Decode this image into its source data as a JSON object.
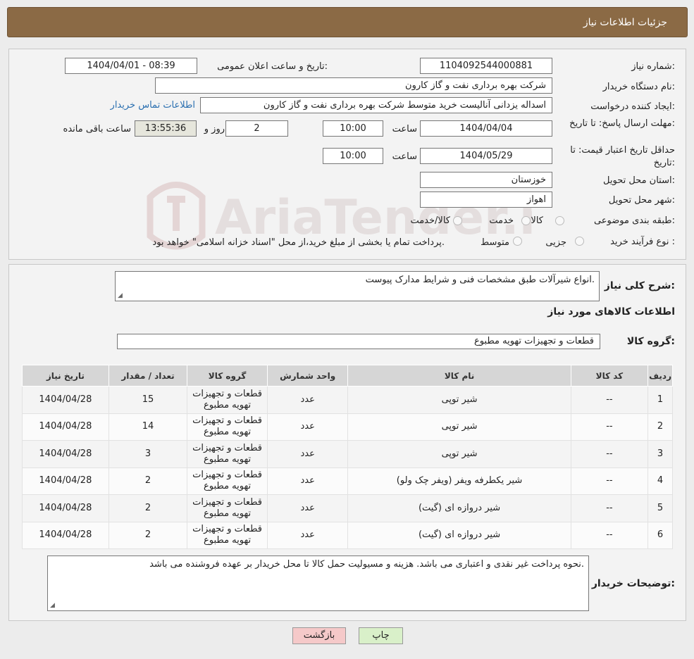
{
  "page": {
    "title": "جزئیات اطلاعات نیاز"
  },
  "need": {
    "number_label": "شماره نیاز:",
    "number": "1104092544000881",
    "announce_label": "تاریخ و ساعت اعلان عمومی:",
    "announce_value": "1404/04/01 - 08:39",
    "buyer_label": "نام دستگاه خریدار:",
    "buyer": "شرکت بهره برداری نفت و گاز کارون",
    "creator_label": "ایجاد کننده درخواست:",
    "creator": "اسداله یزدانی آنالیست خرید متوسط شرکت بهره برداری نفت و گاز کارون",
    "contact_link": "اطلاعات تماس خریدار",
    "deadline_label": "مهلت ارسال پاسخ: تا تاریخ:",
    "deadline_date": "1404/04/04",
    "time_label": "ساعت",
    "deadline_time": "10:00",
    "days": "2",
    "days_label": "روز و",
    "remaining": "13:55:36",
    "remaining_label": "ساعت باقی مانده",
    "validity_label": "حداقل تاریخ اعتبار قیمت: تا تاریخ:",
    "validity_date": "1404/05/29",
    "validity_time": "10:00",
    "province_label": "استان محل تحویل:",
    "province": "خوزستان",
    "city_label": "شهر محل تحویل:",
    "city": "اهواز",
    "category_label": "طبقه بندی موضوعی:",
    "category_options": [
      "کالا",
      "خدمت",
      "کالا/خدمت"
    ],
    "purchase_label": "نوع فرآیند خرید :",
    "purchase_options": [
      "جزیی",
      "متوسط"
    ],
    "purchase_note": "پرداخت تمام یا بخشی از مبلغ خرید،از محل \"اسناد خزانه اسلامی\" خواهد بود."
  },
  "summary": {
    "label": "شرح کلی نیاز:",
    "text": "انواع شیرآلات طبق مشخصات فنی و شرایط مدارک پیوست.",
    "goods_info_title": "اطلاعات کالاهای مورد نیاز",
    "group_label": "گروه کالا:",
    "group_value": "قطعات و تجهیزات تهویه مطبوع"
  },
  "table": {
    "headers": [
      "ردیف",
      "کد کالا",
      "نام کالا",
      "واحد شمارش",
      "گروه کالا",
      "تعداد / مقدار",
      "تاریخ نیاز"
    ],
    "rows": [
      [
        "1",
        "--",
        "شیر توپی",
        "عدد",
        "قطعات و تجهیزات تهویه مطبوع",
        "15",
        "1404/04/28"
      ],
      [
        "2",
        "--",
        "شیر توپی",
        "عدد",
        "قطعات و تجهیزات تهویه مطبوع",
        "14",
        "1404/04/28"
      ],
      [
        "3",
        "--",
        "شیر توپی",
        "عدد",
        "قطعات و تجهیزات تهویه مطبوع",
        "3",
        "1404/04/28"
      ],
      [
        "4",
        "--",
        "شیر یکطرفه ویفر (ویفر چک ولو)",
        "عدد",
        "قطعات و تجهیزات تهویه مطبوع",
        "2",
        "1404/04/28"
      ],
      [
        "5",
        "--",
        "شیر دروازه ای (گیت)",
        "عدد",
        "قطعات و تجهیزات تهویه مطبوع",
        "2",
        "1404/04/28"
      ],
      [
        "6",
        "--",
        "شیر دروازه ای (گیت)",
        "عدد",
        "قطعات و تجهیزات تهویه مطبوع",
        "2",
        "1404/04/28"
      ]
    ]
  },
  "buyer_notes": {
    "label": "توضیحات خریدار:",
    "text": "نحوه پرداخت غیر نقدی و اعتباری می باشد. هزینه و مسیولیت حمل کالا تا محل خریدار بر عهده فروشنده می باشد."
  },
  "buttons": {
    "print": "چاپ",
    "back": "بازگشت"
  },
  "watermark": {
    "text": "AriaTender.neT"
  }
}
